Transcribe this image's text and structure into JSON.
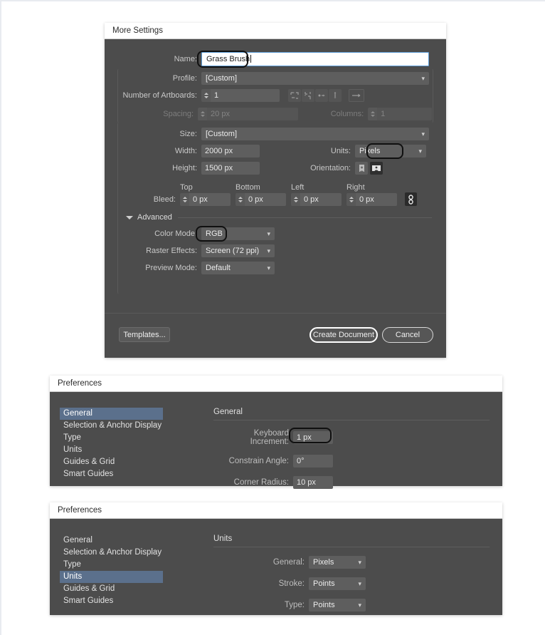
{
  "new_document_dialog": {
    "title": "More Settings",
    "name": {
      "label": "Name:",
      "value": "Grass Brush"
    },
    "profile": {
      "label": "Profile:",
      "value": "[Custom]"
    },
    "artboards": {
      "label": "Number of Artboards:",
      "value": "1",
      "arrange_icons": [
        "grid-by-row-icon",
        "grid-by-column-icon",
        "arrange-left-to-right-icon",
        "arrange-top-to-bottom-icon"
      ],
      "direction_icon": "arrow-right-icon"
    },
    "spacing": {
      "label": "Spacing:",
      "value": "20 px"
    },
    "columns": {
      "label": "Columns:",
      "value": "1"
    },
    "size": {
      "label": "Size:",
      "value": "[Custom]"
    },
    "width": {
      "label": "Width:",
      "value": "2000 px"
    },
    "height": {
      "label": "Height:",
      "value": "1500 px"
    },
    "units": {
      "label": "Units:",
      "value": "Pixels"
    },
    "orientation": {
      "label": "Orientation:",
      "portrait_icon": "portrait-orientation-icon",
      "landscape_icon": "landscape-orientation-icon",
      "selected": "landscape"
    },
    "bleed": {
      "label": "Bleed:",
      "headers": [
        "Top",
        "Bottom",
        "Left",
        "Right"
      ],
      "values": [
        "0 px",
        "0 px",
        "0 px",
        "0 px"
      ],
      "link_icon": "chain-link-icon"
    },
    "advanced": {
      "label": "Advanced",
      "disclosure_icon": "triangle-down-icon",
      "color_mode": {
        "label": "Color Mode:",
        "value": "RGB"
      },
      "raster_effects": {
        "label": "Raster Effects:",
        "value": "Screen (72 ppi)"
      },
      "preview_mode": {
        "label": "Preview Mode:",
        "value": "Default"
      }
    },
    "footer": {
      "templates": "Templates...",
      "create": "Create Document",
      "cancel": "Cancel"
    }
  },
  "preferences_general": {
    "title": "Preferences",
    "categories": [
      "General",
      "Selection & Anchor Display",
      "Type",
      "Units",
      "Guides & Grid",
      "Smart Guides"
    ],
    "selected_category": "General",
    "section_heading": "General",
    "fields": [
      {
        "label": "Keyboard Increment:",
        "value": "1 px"
      },
      {
        "label": "Constrain Angle:",
        "value": "0°"
      },
      {
        "label": "Corner Radius:",
        "value": "10 px"
      }
    ]
  },
  "preferences_units": {
    "title": "Preferences",
    "categories": [
      "General",
      "Selection & Anchor Display",
      "Type",
      "Units",
      "Guides & Grid",
      "Smart Guides"
    ],
    "selected_category": "Units",
    "section_heading": "Units",
    "fields": [
      {
        "label": "General:",
        "value": "Pixels"
      },
      {
        "label": "Stroke:",
        "value": "Points"
      },
      {
        "label": "Type:",
        "value": "Points"
      }
    ]
  },
  "colors": {
    "panel_bg": "#4c4c4c",
    "field_bg": "#5e5e5e",
    "selection_blue": "#5b708c",
    "focus_blue": "#5b9bd5",
    "highlight_outline": "#101010"
  }
}
